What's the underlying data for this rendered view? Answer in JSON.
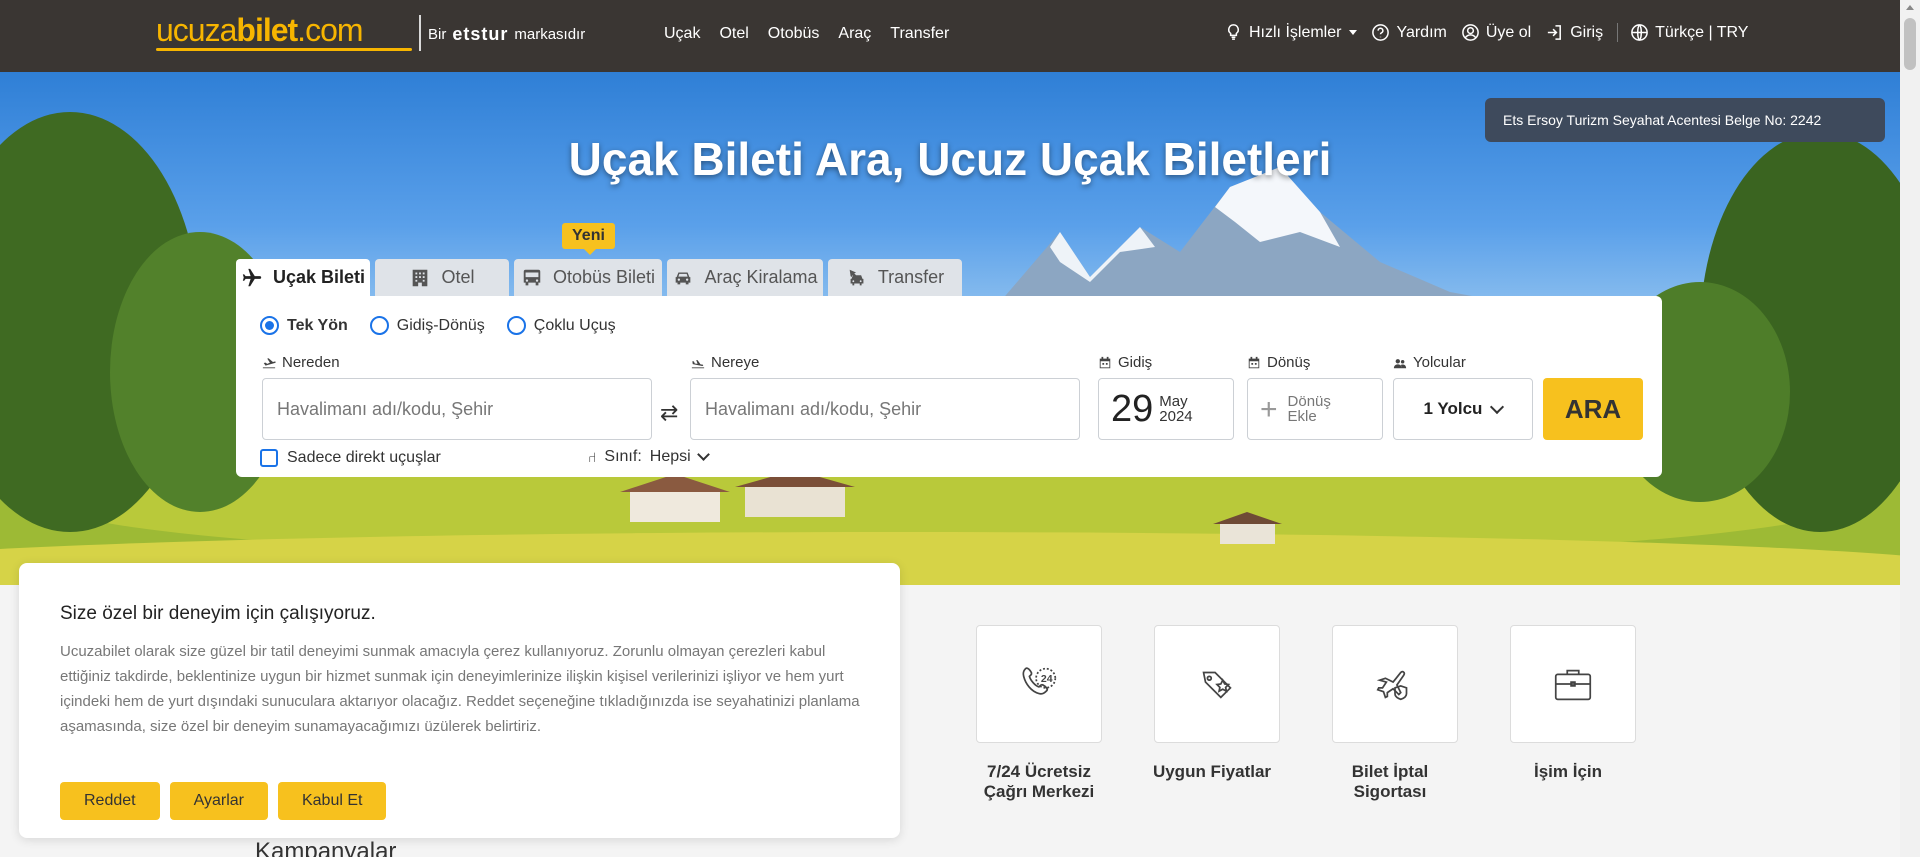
{
  "header": {
    "logo_part1": "ucuza",
    "logo_part2": "bilet",
    "logo_part3": ".com",
    "brand_prefix": "Bir",
    "brand_name": "etstur",
    "brand_suffix": "markasıdır",
    "nav": [
      "Uçak",
      "Otel",
      "Otobüs",
      "Araç",
      "Transfer"
    ],
    "quick_actions": "Hızlı İşlemler",
    "help": "Yardım",
    "signup": "Üye ol",
    "login": "Giriş",
    "language": "Türkçe | TRY"
  },
  "hero": {
    "title": "Uçak Bileti Ara, Ucuz Uçak Biletleri",
    "license": "Ets Ersoy Turizm Seyahat Acentesi Belge No: 2242"
  },
  "tabs": [
    {
      "label": "Uçak Bileti",
      "icon": "plane-icon",
      "active": true
    },
    {
      "label": "Otel",
      "icon": "building-icon",
      "active": false
    },
    {
      "label": "Otobüs Bileti",
      "icon": "bus-icon",
      "active": false
    },
    {
      "label": "Araç Kiralama",
      "icon": "car-icon",
      "active": false
    },
    {
      "label": "Transfer",
      "icon": "transfer-icon",
      "active": false
    }
  ],
  "new_badge": "Yeni",
  "trip_types": [
    {
      "label": "Tek Yön",
      "selected": true
    },
    {
      "label": "Gidiş-Dönüş",
      "selected": false
    },
    {
      "label": "Çoklu Uçuş",
      "selected": false
    }
  ],
  "form": {
    "from_label": "Nereden",
    "from_placeholder": "Havalimanı adı/kodu, Şehir",
    "to_label": "Nereye",
    "to_placeholder": "Havalimanı adı/kodu, Şehir",
    "depart_label": "Gidiş",
    "depart_day": "29",
    "depart_month": "May",
    "depart_year": "2024",
    "return_label": "Dönüş",
    "return_line1": "Dönüş",
    "return_line2": "Ekle",
    "passengers_label": "Yolcular",
    "passengers_value": "1 Yolcu",
    "search_button": "ARA",
    "direct_only": "Sadece direkt uçuşlar",
    "class_label": "Sınıf:",
    "class_value": "Hepsi"
  },
  "features": [
    {
      "label_line1": "7/24 Ücretsiz",
      "label_line2": "Çağrı Merkezi",
      "icon": "support-24-icon"
    },
    {
      "label_line1": "Uygun Fiyatlar",
      "label_line2": "",
      "icon": "price-tag-icon"
    },
    {
      "label_line1": "Bilet İptal",
      "label_line2": "Sigortası",
      "icon": "plane-shield-icon"
    },
    {
      "label_line1": "İşim İçin",
      "label_line2": "",
      "icon": "briefcase-icon"
    }
  ],
  "campaigns_title": "Kampanyalar",
  "cookie": {
    "title": "Size özel bir deneyim için çalışıyoruz.",
    "text": "Ucuzabilet olarak size güzel bir tatil deneyimi sunmak amacıyla çerez kullanıyoruz. Zorunlu olmayan çerezleri kabul ettiğiniz takdirde, beklentinize uygun bir hizmet sunmak için deneyimlerinize ilişkin kişisel verilerinizi işliyor ve hem yurt içindeki hem de yurt dışındaki sunuculara aktarıyor olacağız. Reddet seçeneğine tıkladığınızda ise seyahatinizi planlama aşamasında, size özel bir deneyim sunamayacağımızı üzülerek belirtiriz.",
    "reject": "Reddet",
    "settings": "Ayarlar",
    "accept": "Kabul Et"
  },
  "colors": {
    "brand_yellow": "#f7c11e",
    "header_bg": "#3a3633",
    "radio_blue": "#1a73e8"
  }
}
